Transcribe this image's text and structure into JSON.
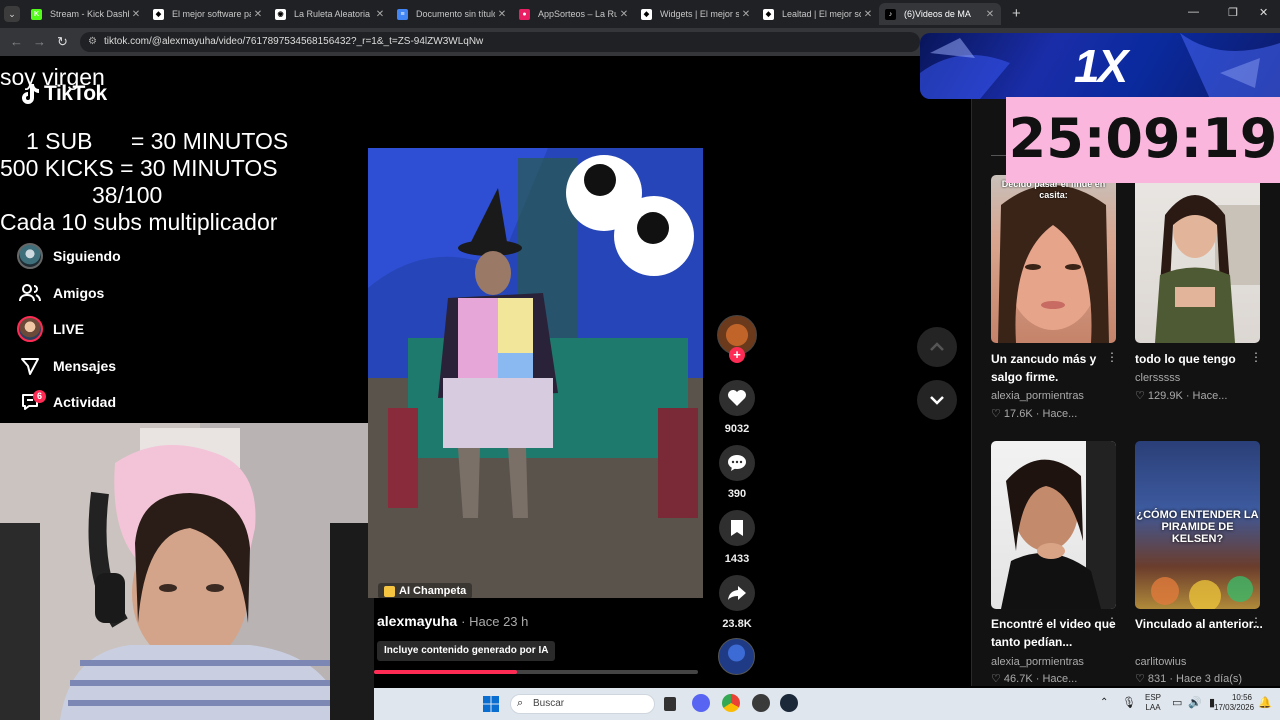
{
  "browser": {
    "tabs": [
      {
        "title": "Stream - Kick Dashbo",
        "favicon_color": "#53fc18",
        "favicon_glyph": "K",
        "active": false
      },
      {
        "title": "El mejor software pa",
        "favicon_color": "#ffffff",
        "favicon_glyph": "◆",
        "active": false
      },
      {
        "title": "La Ruleta Aleatoria",
        "favicon_color": "#ffffff",
        "favicon_glyph": "◉",
        "active": false
      },
      {
        "title": "Documento sin título",
        "favicon_color": "#4285f4",
        "favicon_glyph": "≡",
        "active": false
      },
      {
        "title": "AppSorteos – La Rule",
        "favicon_color": "#e91e63",
        "favicon_glyph": "●",
        "active": false
      },
      {
        "title": "Widgets | El mejor so",
        "favicon_color": "#ffffff",
        "favicon_glyph": "◆",
        "active": false
      },
      {
        "title": "Lealtad | El mejor sof",
        "favicon_color": "#ffffff",
        "favicon_glyph": "◆",
        "active": false
      },
      {
        "title": "(6)Videos de MA",
        "favicon_color": "#000000",
        "favicon_glyph": "♪",
        "active": true
      }
    ],
    "url": "tiktok.com/@alexmayuha/video/7617897534568156432?_r=1&_t=ZS-94lZW3WLqNw"
  },
  "overlay": {
    "line_top": "soy virgen",
    "line1": "1 SUB      = 30 MINUTOS",
    "line2": "500 KICKS = 30 MINUTOS",
    "line3": "38/100",
    "line4": "Cada 10 subs multiplicador",
    "sponsor": "1X",
    "timer": "25:09:19"
  },
  "tiktok": {
    "logo": "TikTok",
    "nav": {
      "following": "Siguiendo",
      "friends": "Amigos",
      "live": "LIVE",
      "messages": "Mensajes",
      "activity": "Actividad",
      "activity_badge": "6"
    },
    "video": {
      "tag": "AI Champeta",
      "author": "alexmayuha",
      "time": "· Hace 23 h",
      "ai_label": "Incluye contenido generado por IA",
      "progress": 0.44,
      "likes": "9032",
      "comments": "390",
      "saves": "1433",
      "shares": "23.8K"
    },
    "suggested": [
      {
        "title": "Un zancudo más y salgo firme.",
        "author": "alexia_pormientras",
        "stats": "♡ 17.6K · Hace...",
        "thumb_caption": "Decido pasar el finde en casita:"
      },
      {
        "title": "todo lo que tengo",
        "author": "clersssss",
        "stats": "♡ 129.9K · Hace...",
        "thumb_caption": ""
      },
      {
        "title": "Encontré el video que tanto pedían...",
        "author": "alexia_pormientras",
        "stats": "♡ 46.7K · Hace...",
        "thumb_caption": ""
      },
      {
        "title": "Vinculado al anterior...",
        "author": "carlitowius",
        "stats": "♡ 831 · Hace 3 día(s)",
        "thumb_caption": "¿CÓMO ENTENDER LA PIRAMIDE DE KELSEN?"
      }
    ]
  },
  "taskbar": {
    "search_placeholder": "Buscar",
    "lang_top": "ESP",
    "lang_bottom": "LAA",
    "time": "10:56",
    "date": "17/03/2026"
  },
  "colors": {
    "accent": "#fe2c55",
    "timer_bg": "#fbb6dd"
  }
}
